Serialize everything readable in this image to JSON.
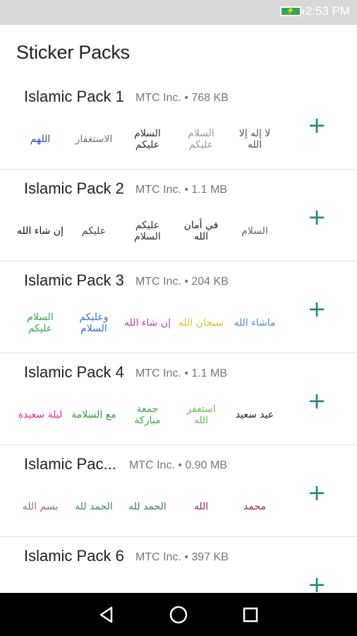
{
  "status_bar": {
    "time": "2:53 PM",
    "battery_icon": "battery-charging-icon"
  },
  "header": {
    "title": "Sticker Packs"
  },
  "packs": [
    {
      "title": "Islamic Pack 1",
      "meta": "MTC Inc. • 768 KB",
      "stickers": [
        "اللهم",
        "الاستغفار",
        "السلام عليكم",
        "السلام عليكم",
        "لا إله إلا الله"
      ],
      "colors": [
        "#2b4fb8",
        "#777777",
        "#333333",
        "#999999",
        "#555555"
      ]
    },
    {
      "title": "Islamic Pack 2",
      "meta": "MTC Inc. • 1.1 MB",
      "stickers": [
        "إن شاء الله",
        "عليكم",
        "عليكم السلام",
        "في أمان الله",
        "السلام"
      ],
      "colors": [
        "#111111",
        "#444444",
        "#333333",
        "#222222",
        "#666666"
      ]
    },
    {
      "title": "Islamic Pack 3",
      "meta": "MTC Inc. • 204 KB",
      "stickers": [
        "السلام عليكم",
        "وعليكم السلام",
        "إن شاء الله",
        "سبحان الله",
        "ماشاء الله"
      ],
      "colors": [
        "#3aa845",
        "#3a6fd8",
        "#c33bc3",
        "#d8c12a",
        "#4a8fe0"
      ]
    },
    {
      "title": "Islamic Pack 4",
      "meta": "MTC Inc. • 1.1 MB",
      "stickers": [
        "ليلة سعيدة",
        "مع السلامة",
        "جمعة مباركة",
        "استغفر الله",
        "عيد سعيد"
      ],
      "colors": [
        "#e0309a",
        "#2f9c3a",
        "#3aa845",
        "#6cbf5a",
        "#222222"
      ]
    },
    {
      "title": "Islamic Pac...",
      "meta": "MTC Inc. • 0.90 MB",
      "stickers": [
        "بسم الله",
        "الحمد لله",
        "الحمد لله",
        "الله",
        "محمد"
      ],
      "colors": [
        "#a06a8a",
        "#3a8f7a",
        "#3b7b6a",
        "#a02a5a",
        "#a0265a"
      ]
    },
    {
      "title": "Islamic Pack 6",
      "meta": "MTC Inc. • 397 KB",
      "stickers": [
        "",
        "",
        "",
        "",
        ""
      ],
      "colors": [
        "#888888",
        "#c23a9a",
        "#3aa845",
        "#e04060",
        "#e0c030"
      ]
    }
  ]
}
